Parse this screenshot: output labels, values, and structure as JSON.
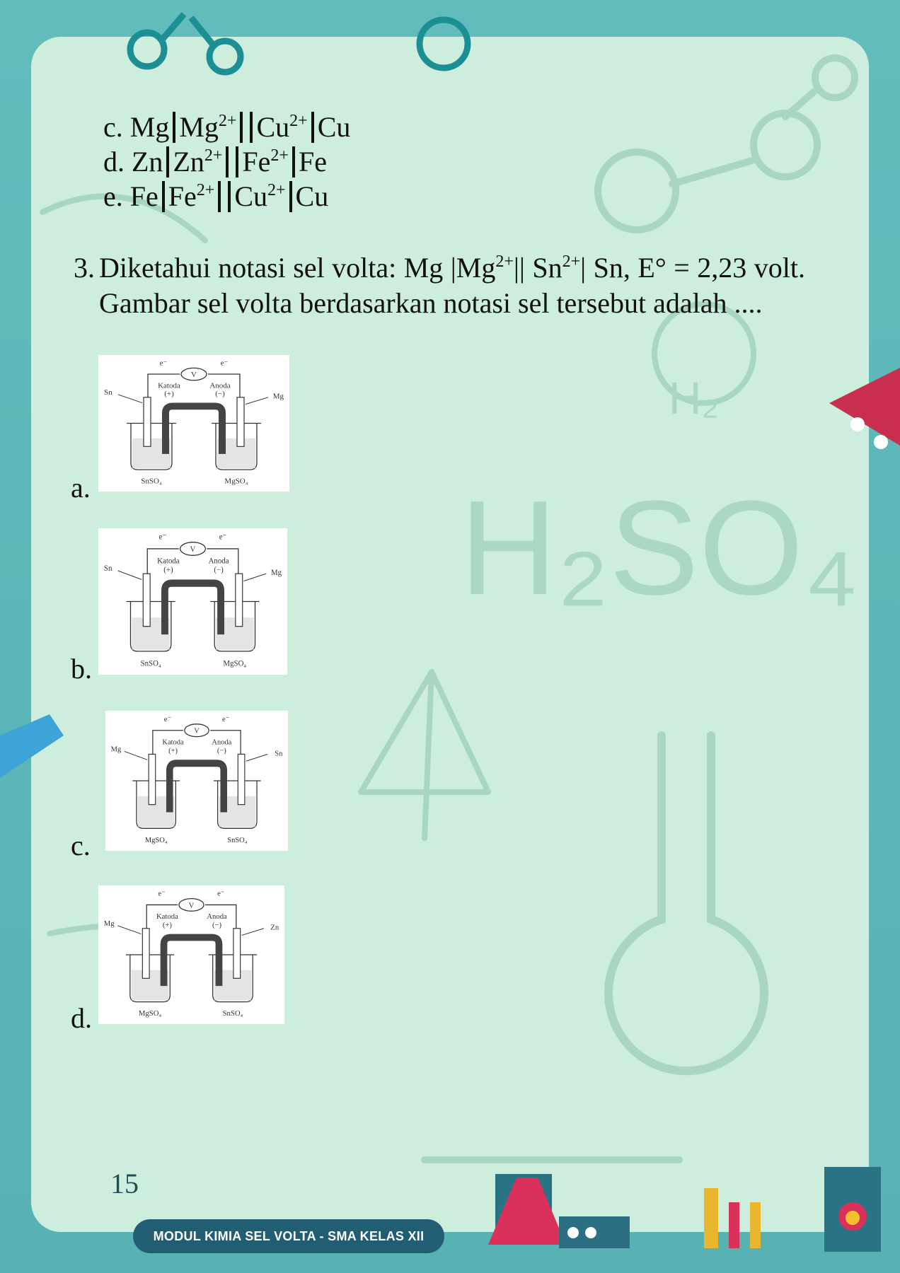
{
  "options_prev": {
    "c": {
      "label": "c.",
      "text": "Mg│Mg2+││Cu2+│Cu"
    },
    "d": {
      "label": "d.",
      "text": "Zn│Zn2+││Fe2+│Fe"
    },
    "e": {
      "label": "e.",
      "text": "Fe│Fe2+││Cu2+│Cu"
    }
  },
  "question": {
    "number": "3.",
    "text_part1": "Diketahui notasi sel volta: Mg |Mg",
    "sup1": "2+",
    "text_part2": "|| Sn",
    "sup2": "2+",
    "text_part3": "| Sn, E° = 2,23 volt. Gambar sel volta berdasarkan notasi sel tersebut adalah ...."
  },
  "choices": [
    {
      "label": "a.",
      "left_electrode": "Sn",
      "right_electrode": "Mg",
      "left_solution": "SnSO₄",
      "right_solution": "MgSO₄",
      "left_pole": "Katoda",
      "left_sign": "(+)",
      "right_pole": "Anoda",
      "right_sign": "(−)",
      "electron": "e⁻",
      "meter": "V"
    },
    {
      "label": "b.",
      "left_electrode": "Sn",
      "right_electrode": "Mg",
      "left_solution": "SnSO₄",
      "right_solution": "MgSO₄",
      "left_pole": "Katoda",
      "left_sign": "(+)",
      "right_pole": "Anoda",
      "right_sign": "(−)",
      "electron": "e⁻",
      "meter": "V"
    },
    {
      "label": "c.",
      "left_electrode": "Mg",
      "right_electrode": "Sn",
      "left_solution": "MgSO₄",
      "right_solution": "SnSO₄",
      "left_pole": "Katoda",
      "left_sign": "(+)",
      "right_pole": "Anoda",
      "right_sign": "(−)",
      "electron": "e⁻",
      "meter": "V"
    },
    {
      "label": "d.",
      "left_electrode": "Mg",
      "right_electrode": "Zn",
      "left_solution": "MgSO₄",
      "right_solution": "SnSO₄",
      "left_pole": "Katoda",
      "left_sign": "(+)",
      "right_pole": "Anoda",
      "right_sign": "(−)",
      "electron": "e⁻",
      "meter": "V"
    }
  ],
  "page_number": "15",
  "footer": "MODUL KIMIA SEL VOLTA - SMA KELAS XII",
  "colors": {
    "frame": "#5fb8b8",
    "panel": "#cdeedd",
    "footer": "#215e74"
  }
}
